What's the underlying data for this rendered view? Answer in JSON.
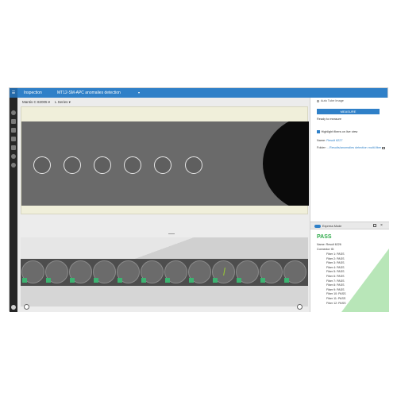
{
  "titlebar": {
    "title": "Inspection",
    "tab": "MT12-SM-APC anomalies detection",
    "caret": "▾",
    "menu_icon": "☰"
  },
  "toolbar": {
    "camera": "Mantis C 82005 ▾",
    "series": "L Series ▾"
  },
  "right_panel": {
    "auto_tube_label": "Auto Tube Image",
    "measure_label": "MEASURE",
    "ready_text": "Ready to measure",
    "highlight_label": "Highlight fibers on live view",
    "name_label": "Name:",
    "name_value": "Result 6227",
    "folder_label": "Folder:",
    "folder_value": "...Results/anomalies detection multi-fiber"
  },
  "express": {
    "label": "Express Mode"
  },
  "results": {
    "status": "PASS",
    "name_label": "Name:",
    "name_value": "Result 6226",
    "connector_id_label": "Connector ID:",
    "fibers": [
      "Fiber 1: PASS",
      "Fiber 2: PASS",
      "Fiber 3: PASS",
      "Fiber 4: PASS",
      "Fiber 5: PASS",
      "Fiber 6: PASS",
      "Fiber 7: PASS",
      "Fiber 8: PASS",
      "Fiber 9: PASS",
      "Fiber 10: PASS",
      "Fiber 11: PASS",
      "Fiber 12: PASS"
    ]
  },
  "colors": {
    "accent": "#2f80c8",
    "pass": "#2eaa4a",
    "sidebar": "#262626"
  }
}
